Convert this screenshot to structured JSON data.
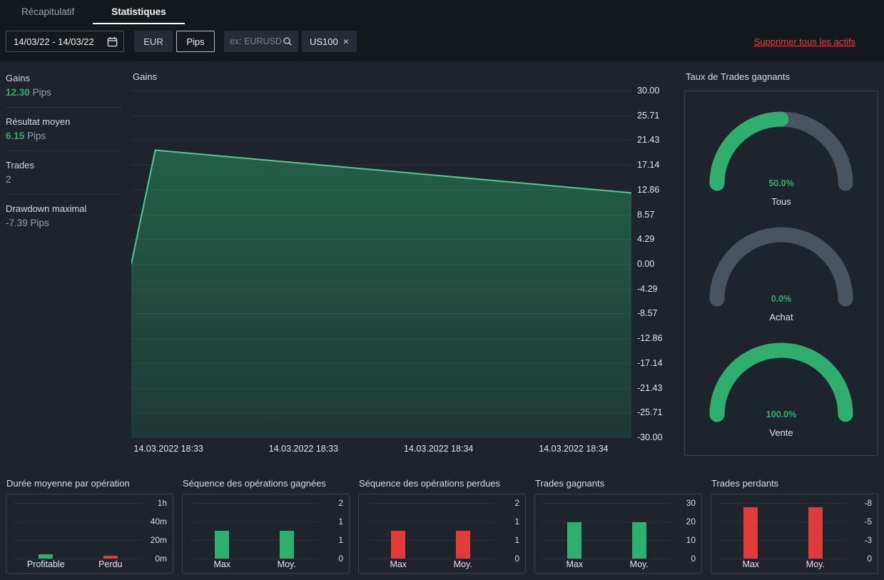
{
  "tabs": [
    {
      "label": "Récapitulatif",
      "active": false
    },
    {
      "label": "Statistiques",
      "active": true
    }
  ],
  "toolbar": {
    "date_range": "14/03/22 - 14/03/22",
    "currency_button": "EUR",
    "units_button": "Pips",
    "search_placeholder": "ex: EURUSD",
    "asset_tag": "US100",
    "asset_tag_remove": "×",
    "delete_all_link": "Supprimer tous les actifs"
  },
  "stats": [
    {
      "label": "Gains",
      "value": "12.30",
      "unit": "Pips"
    },
    {
      "label": "Résultat moyen",
      "value": "6.15",
      "unit": "Pips"
    },
    {
      "label": "Trades",
      "value": "2",
      "unit": ""
    },
    {
      "label": "Drawdown maximal",
      "value": "-7.39",
      "unit": "Pips"
    }
  ],
  "colors": {
    "background": "#1d242b",
    "header_background": "#14191e",
    "panel_border": "#39424b",
    "accent_green": "#2fae6d",
    "line_green": "#58c797",
    "red": "#e13b3b",
    "link_red": "#e14444",
    "gauge_track": "#4a545e",
    "text_primary": "#e2e6ea",
    "text_muted": "#9aa3ab"
  },
  "chart_data": [
    {
      "id": "gains_area",
      "type": "area",
      "title": "Gains",
      "ylim": [
        -30,
        30
      ],
      "y_ticks": [
        "30.00",
        "25.71",
        "21.43",
        "17.14",
        "12.86",
        "8.57",
        "4.29",
        "0.00",
        "-4.29",
        "-8.57",
        "-12.86",
        "-17.14",
        "-21.43",
        "-25.71",
        "-30.00"
      ],
      "x_tick_labels": [
        "14.03.2022 18:33",
        "14.03.2022 18:33",
        "14.03.2022 18:34",
        "14.03.2022 18:34"
      ],
      "points": [
        {
          "x": 0.0,
          "y": 0.0
        },
        {
          "x": 0.048,
          "y": 19.69
        },
        {
          "x": 1.0,
          "y": 12.3
        }
      ],
      "line_color": "#58c797",
      "fill_color": "#2aa76b",
      "grid": true,
      "yaxis_position": "right"
    },
    {
      "id": "win_rate_gauges",
      "type": "gauge",
      "title": "Taux de Trades gagnants",
      "gauges": [
        {
          "label": "Tous",
          "percent": 50.0,
          "display": "50.0%"
        },
        {
          "label": "Achat",
          "percent": 0.0,
          "display": "0.0%"
        },
        {
          "label": "Vente",
          "percent": 100.0,
          "display": "100.0%"
        }
      ]
    },
    {
      "id": "avg_duration",
      "type": "bar",
      "title": "Durée moyenne par opération",
      "categories": [
        "Profitable",
        "Perdu"
      ],
      "values": [
        5,
        3
      ],
      "value_unit": "minutes (estimated from chart)",
      "ylim": [
        0,
        60
      ],
      "y_ticks": [
        "1h",
        "40m",
        "20m",
        "0m"
      ],
      "bar_colors": [
        "#2fae6d",
        "#e13b3b"
      ]
    },
    {
      "id": "win_streak",
      "type": "bar",
      "title": "Séquence des opérations gagnées",
      "categories": [
        "Max",
        "Moy."
      ],
      "values": [
        1,
        1
      ],
      "ylim": [
        0,
        2
      ],
      "y_ticks": [
        "2",
        "1",
        "1",
        "0"
      ],
      "bar_colors": [
        "#2fae6d",
        "#2fae6d"
      ]
    },
    {
      "id": "loss_streak",
      "type": "bar",
      "title": "Séquence des opérations perdues",
      "categories": [
        "Max",
        "Moy."
      ],
      "values": [
        1,
        1
      ],
      "ylim": [
        0,
        2
      ],
      "y_ticks": [
        "2",
        "1",
        "1",
        "0"
      ],
      "bar_colors": [
        "#e13b3b",
        "#e13b3b"
      ]
    },
    {
      "id": "winning_trades",
      "type": "bar",
      "title": "Trades gagnants",
      "categories": [
        "Max",
        "Moy."
      ],
      "values": [
        19.69,
        19.69
      ],
      "ylim": [
        0,
        30
      ],
      "y_ticks": [
        "30",
        "20",
        "10",
        "0"
      ],
      "bar_colors": [
        "#2fae6d",
        "#2fae6d"
      ]
    },
    {
      "id": "losing_trades",
      "type": "bar",
      "title": "Trades perdants",
      "categories": [
        "Max",
        "Moy."
      ],
      "values": [
        -7.39,
        -7.39
      ],
      "ylim": [
        0,
        -8
      ],
      "y_ticks": [
        "-8",
        "-5",
        "-3",
        "0"
      ],
      "bar_colors": [
        "#e13b3b",
        "#e13b3b"
      ]
    }
  ]
}
